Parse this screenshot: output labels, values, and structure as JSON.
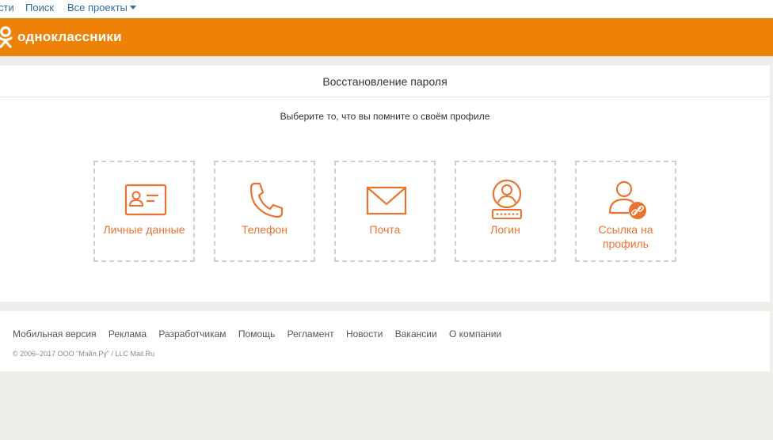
{
  "topbar": {
    "news_partial": "сти",
    "search": "Поиск",
    "all_projects": "Все проекты"
  },
  "header": {
    "logo_text": "одноклассники",
    "brand_color": "#ee8208"
  },
  "card": {
    "title": "Восстановление пароля",
    "subtitle": "Выберите то, что вы помните о своём профиле",
    "accent_color": "#eb722e",
    "options": [
      {
        "label": "Личные данные",
        "icon": "id-card-icon"
      },
      {
        "label": "Телефон",
        "icon": "phone-icon"
      },
      {
        "label": "Почта",
        "icon": "mail-icon"
      },
      {
        "label": "Логин",
        "icon": "login-icon"
      },
      {
        "label": "Ссылка на профиль",
        "icon": "profile-link-icon"
      }
    ]
  },
  "footer": {
    "links": [
      "Мобильная версия",
      "Реклама",
      "Разработчикам",
      "Помощь",
      "Регламент",
      "Новости",
      "Вакансии",
      "О компании"
    ],
    "copyright": "© 2006–2017 ООО \"Мэйл.Ру\" / LLC Mail.Ru"
  }
}
